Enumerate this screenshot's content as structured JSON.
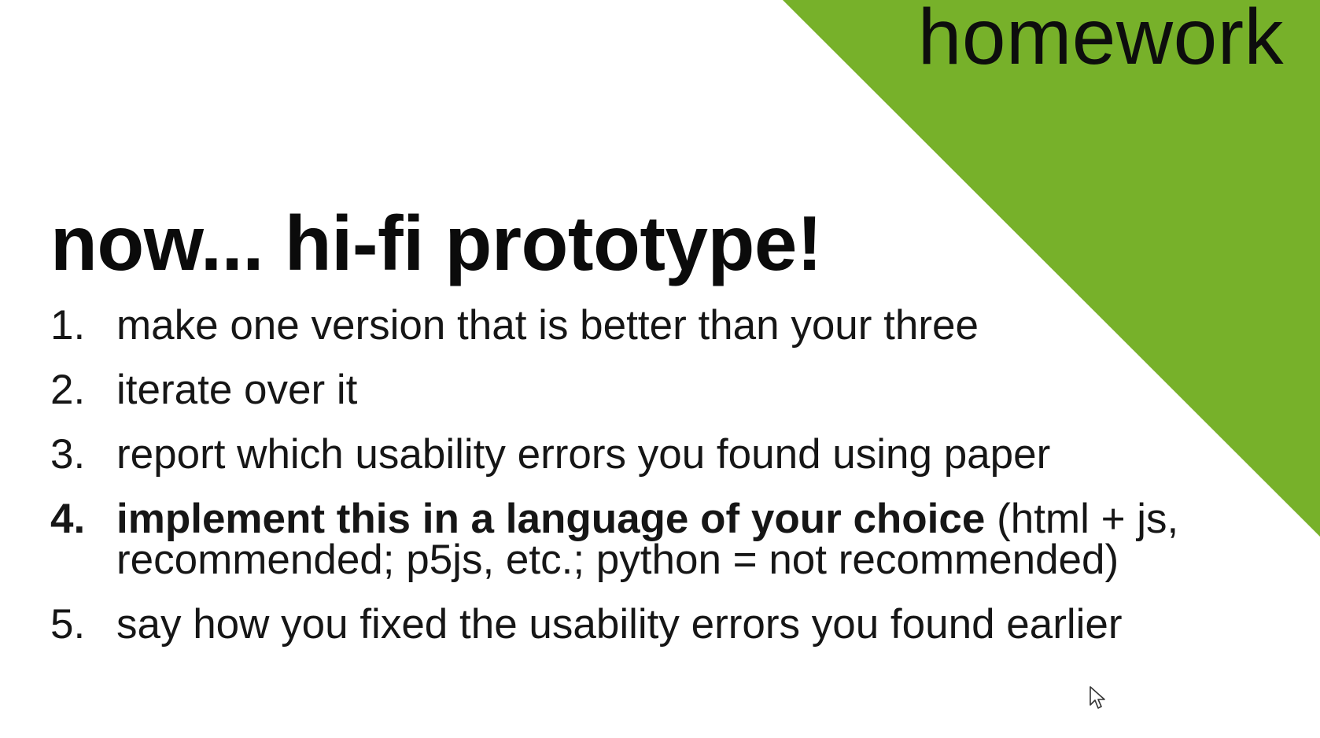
{
  "slide": {
    "section_tag": "homework",
    "title": "now... hi-fi prototype!",
    "accent_color": "#77b12a",
    "steps": [
      {
        "number": "1.",
        "text": "make one version that is better than your three"
      },
      {
        "number": "2.",
        "text": "iterate over it"
      },
      {
        "number": "3.",
        "text": "report which usability errors you found using paper"
      },
      {
        "number": "4.",
        "strong": "implement this in a language of your choice",
        "text": " (html + js, recommended; p5js, etc.; python = not recommended)"
      },
      {
        "number": "5.",
        "text": "say how you fixed the usability errors you found earlier"
      }
    ]
  },
  "icons": {
    "cursor": "mouse-pointer-icon"
  }
}
